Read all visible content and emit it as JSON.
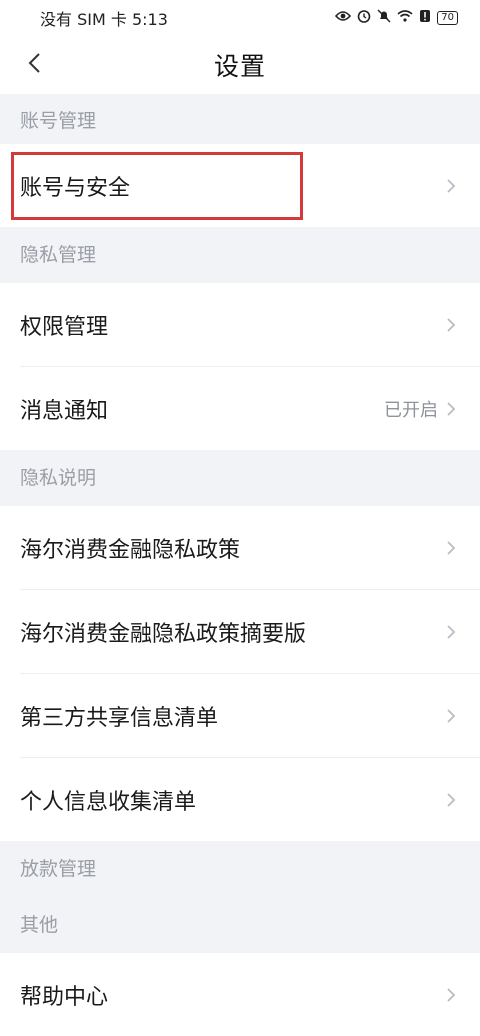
{
  "status_bar": {
    "carrier_time": "没有 SIM 卡 5:13",
    "battery": "70"
  },
  "header": {
    "title": "设置"
  },
  "sections": {
    "account": {
      "title": "账号管理",
      "items": [
        {
          "label": "账号与安全"
        }
      ]
    },
    "privacy": {
      "title": "隐私管理",
      "items": [
        {
          "label": "权限管理"
        },
        {
          "label": "消息通知",
          "value": "已开启"
        }
      ]
    },
    "privacy_notes": {
      "title": "隐私说明",
      "items": [
        {
          "label": "海尔消费金融隐私政策"
        },
        {
          "label": "海尔消费金融隐私政策摘要版"
        },
        {
          "label": "第三方共享信息清单"
        },
        {
          "label": "个人信息收集清单"
        }
      ]
    },
    "loan": {
      "title": "放款管理"
    },
    "other": {
      "title": "其他",
      "items": [
        {
          "label": "帮助中心"
        }
      ]
    }
  },
  "colors": {
    "highlight": "#d43a3a",
    "section_bg": "#f1f3f7",
    "muted_text": "#9a9ea6"
  }
}
